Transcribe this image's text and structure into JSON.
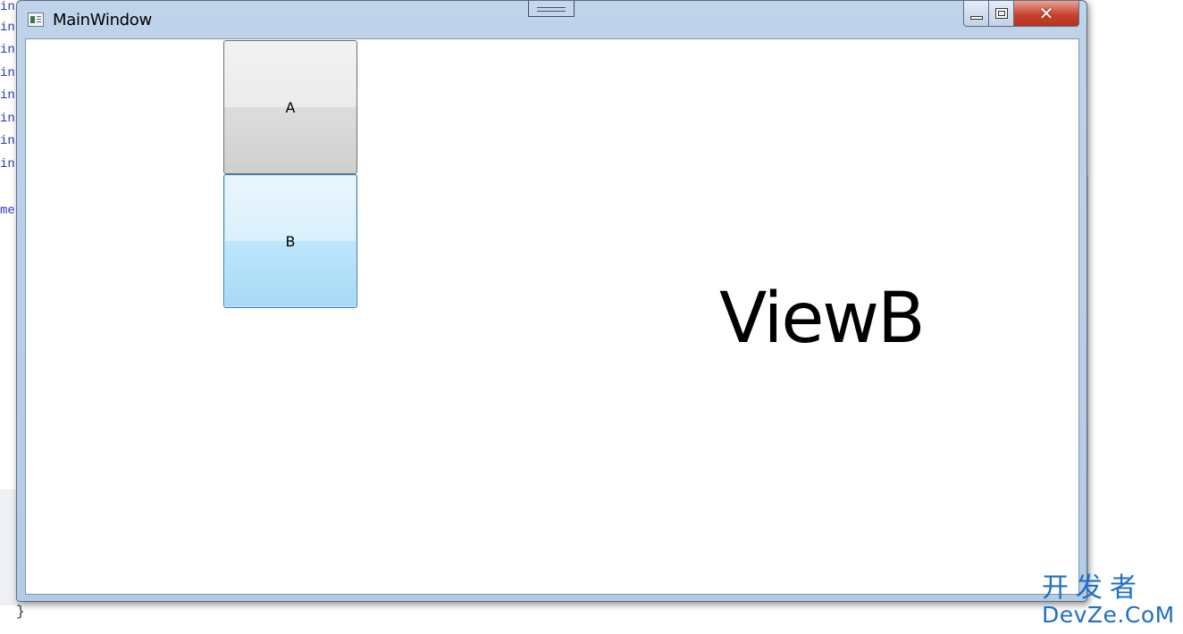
{
  "background": {
    "code_lines": [
      "in",
      "in",
      "in",
      "in",
      "in",
      "in",
      "in",
      "in",
      "me"
    ],
    "closing_brace": "}"
  },
  "window": {
    "title": "MainWindow",
    "icons": {
      "app": "window-app-icon",
      "minimize": "minimize-icon",
      "maximize": "maximize-icon",
      "close": "close-icon",
      "grip": "window-grip-icon"
    },
    "close_glyph": "✕"
  },
  "content": {
    "button_a_label": "A",
    "button_b_label": "B",
    "view_label": "ViewB"
  },
  "watermark": {
    "chinese": "开发者",
    "english": "DevZe.CoM",
    "color": "#1f6fc4"
  }
}
